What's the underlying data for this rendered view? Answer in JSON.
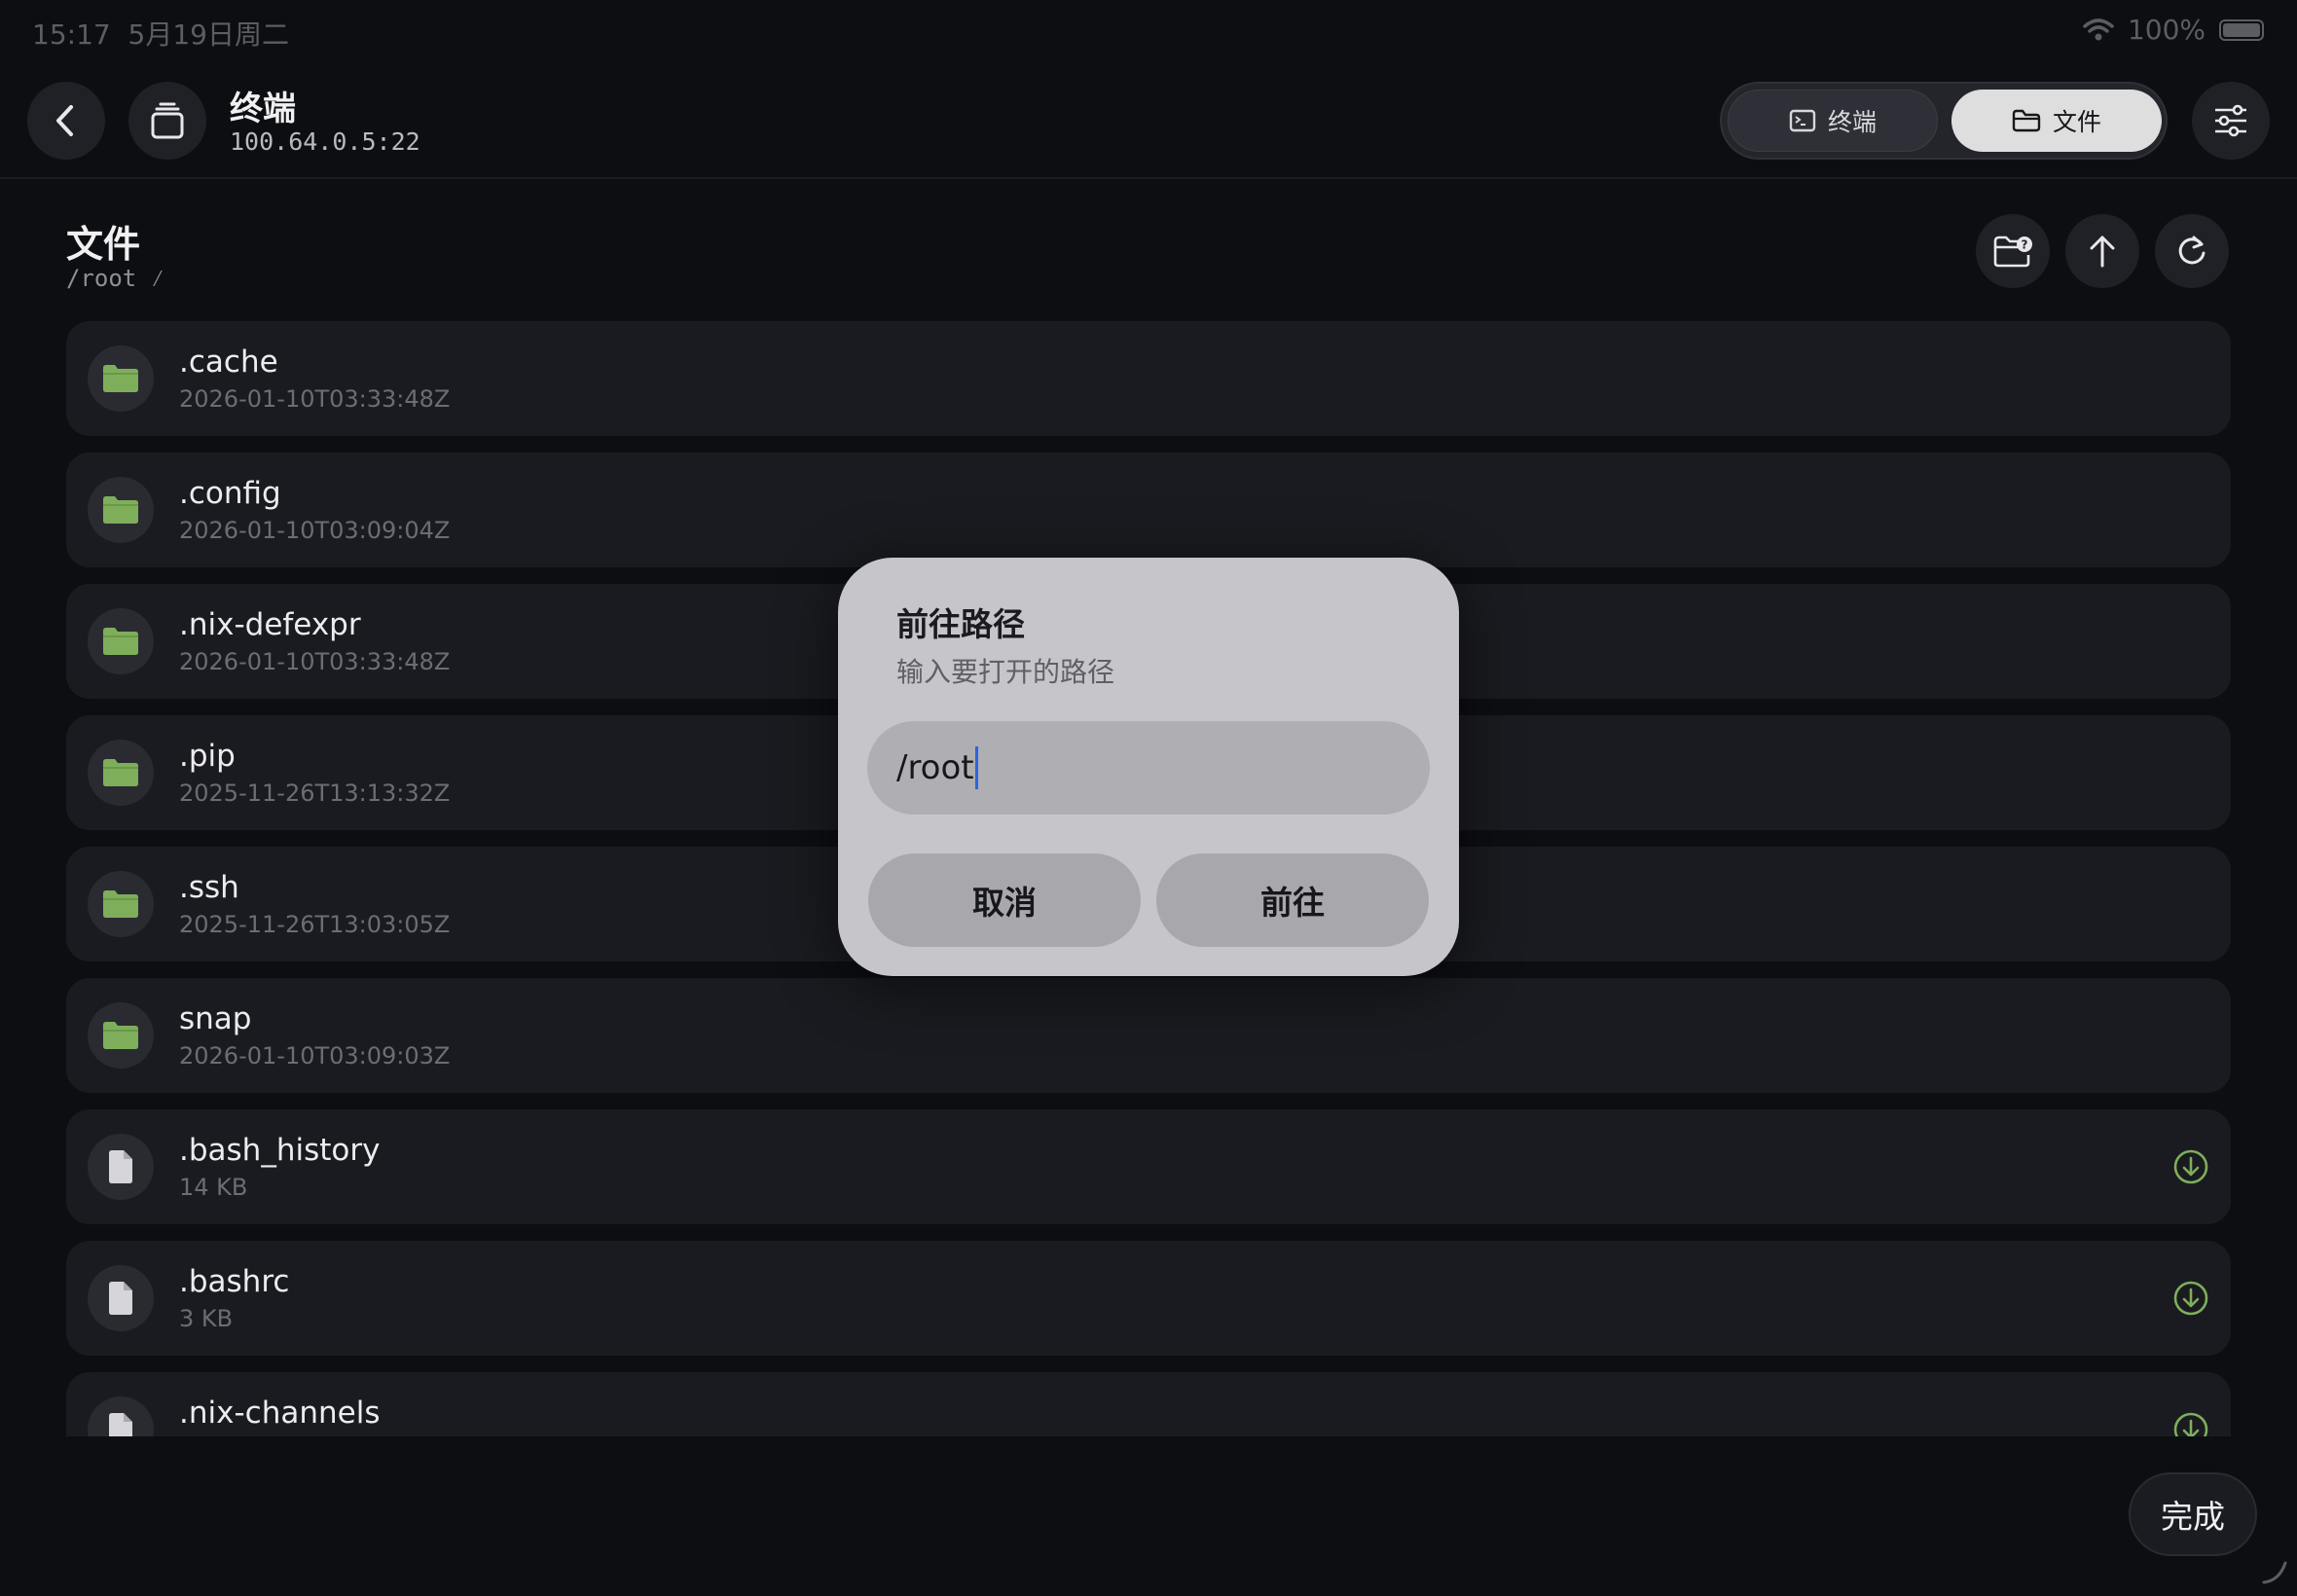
{
  "status_bar": {
    "time": "15:17",
    "date": "5月19日周二",
    "battery": "100%"
  },
  "header": {
    "title": "终端",
    "subtitle": "100.64.0.5:22",
    "segments": [
      {
        "label": "终端"
      },
      {
        "label": "文件"
      }
    ],
    "active_segment": "文件"
  },
  "section": {
    "title": "文件",
    "path": "/root ⁄"
  },
  "files": [
    {
      "name": ".cache",
      "sub": "2026-01-10T03:33:48Z",
      "kind": "folder"
    },
    {
      "name": ".config",
      "sub": "2026-01-10T03:09:04Z",
      "kind": "folder"
    },
    {
      "name": ".nix-defexpr",
      "sub": "2026-01-10T03:33:48Z",
      "kind": "folder"
    },
    {
      "name": ".pip",
      "sub": "2025-11-26T13:13:32Z",
      "kind": "folder"
    },
    {
      "name": ".ssh",
      "sub": "2025-11-26T13:03:05Z",
      "kind": "folder"
    },
    {
      "name": "snap",
      "sub": "2026-01-10T03:09:03Z",
      "kind": "folder"
    },
    {
      "name": ".bash_history",
      "sub": "14 KB",
      "kind": "file"
    },
    {
      "name": ".bashrc",
      "sub": "3 KB",
      "kind": "file"
    },
    {
      "name": ".nix-channels",
      "sub": "",
      "kind": "file"
    }
  ],
  "dialog": {
    "title": "前往路径",
    "message": "输入要打开的路径",
    "input_value": "/root",
    "cancel_label": "取消",
    "confirm_label": "前往"
  },
  "done_label": "完成",
  "colors": {
    "folder": "#7fae5b",
    "download": "#7fae5b",
    "accent_caret": "#2a64e0"
  }
}
